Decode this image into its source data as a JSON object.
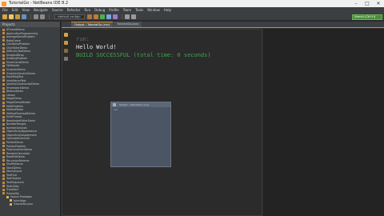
{
  "window": {
    "title": "TutorialGo - NetBeans IDE 8.2",
    "min": "–",
    "max": "□",
    "close": "✕"
  },
  "menubar": [
    "File",
    "Edit",
    "View",
    "Navigate",
    "Source",
    "Refactor",
    "Run",
    "Debug",
    "Profile",
    "Team",
    "Tools",
    "Window",
    "Help"
  ],
  "toolbar": {
    "config_combo": "<default config>",
    "search_placeholder": "Search (Ctrl+I)"
  },
  "projects_panel": {
    "title": "Projects",
    "items": [
      {
        "label": "AThreadDemo"
      },
      {
        "label": "ApplicationProgramming"
      },
      {
        "label": "AverageDemoProblem"
      },
      {
        "label": "BaltaGame"
      },
      {
        "label": "CalcDemoProblem"
      },
      {
        "label": "CharSliderDemo"
      },
      {
        "label": "DifficultyTestDemo"
      },
      {
        "label": "DragAndDrop"
      },
      {
        "label": "DrawingProblem"
      },
      {
        "label": "EnumConstDemo"
      },
      {
        "label": "FileReader"
      },
      {
        "label": "GraphicsDemo"
      },
      {
        "label": "GraphicsGenericDemo"
      },
      {
        "label": "HashMapTest"
      },
      {
        "label": "InheritanceTest"
      },
      {
        "label": "JavaUseConstructorDemo"
      },
      {
        "label": "JFrameworkDemo"
      },
      {
        "label": "JButtonDemo"
      },
      {
        "label": "Lesson"
      },
      {
        "label": "MagicDemo"
      },
      {
        "label": "MagicDemoReader"
      },
      {
        "label": "MathProblem"
      },
      {
        "label": "MethodTester"
      },
      {
        "label": "MethodOverloadDemo"
      },
      {
        "label": "MultiThread"
      },
      {
        "label": "NewAvatarEditorGame"
      },
      {
        "label": "NumberRanges"
      },
      {
        "label": "NumberAnalysis"
      },
      {
        "label": "ObjectArrayAppearance"
      },
      {
        "label": "ObjectArrayAssignment"
      },
      {
        "label": "OptimizeEvenSum"
      },
      {
        "label": "PointerDemo"
      },
      {
        "label": "PointerProblem"
      },
      {
        "label": "PolymorphismDemo"
      },
      {
        "label": "RandomCalculator"
      },
      {
        "label": "ReadFileDemo"
      },
      {
        "label": "RecursionReverse"
      },
      {
        "label": "ShuffleDemo"
      },
      {
        "label": "StackDemo"
      },
      {
        "label": "StackQueue"
      },
      {
        "label": "TestFind"
      },
      {
        "label": "TestObjects"
      },
      {
        "label": "TestSequence"
      },
      {
        "label": "TestUtility"
      },
      {
        "label": "TriviaSort"
      },
      {
        "label": "TutorialGo"
      },
      {
        "label": "Source Packages",
        "level": 1
      },
      {
        "label": "tutorialgo",
        "level": 2
      },
      {
        "label": "TutorialGo.java",
        "level": 2
      }
    ]
  },
  "editor": {
    "tabs": [
      {
        "label": "Output - TutorialGo (run)",
        "active": true
      },
      {
        "label": "TutorialGo.java",
        "active": false
      }
    ],
    "output_lines": [
      "run:",
      "Hello World!",
      "BUILD SUCCESSFUL (total time: 0 seconds)"
    ]
  },
  "floating_window": {
    "title": "Output - TutorialGo (run)",
    "text": "run:"
  },
  "colors": {
    "accent": "#e08a1e",
    "success": "#3fa34d"
  }
}
